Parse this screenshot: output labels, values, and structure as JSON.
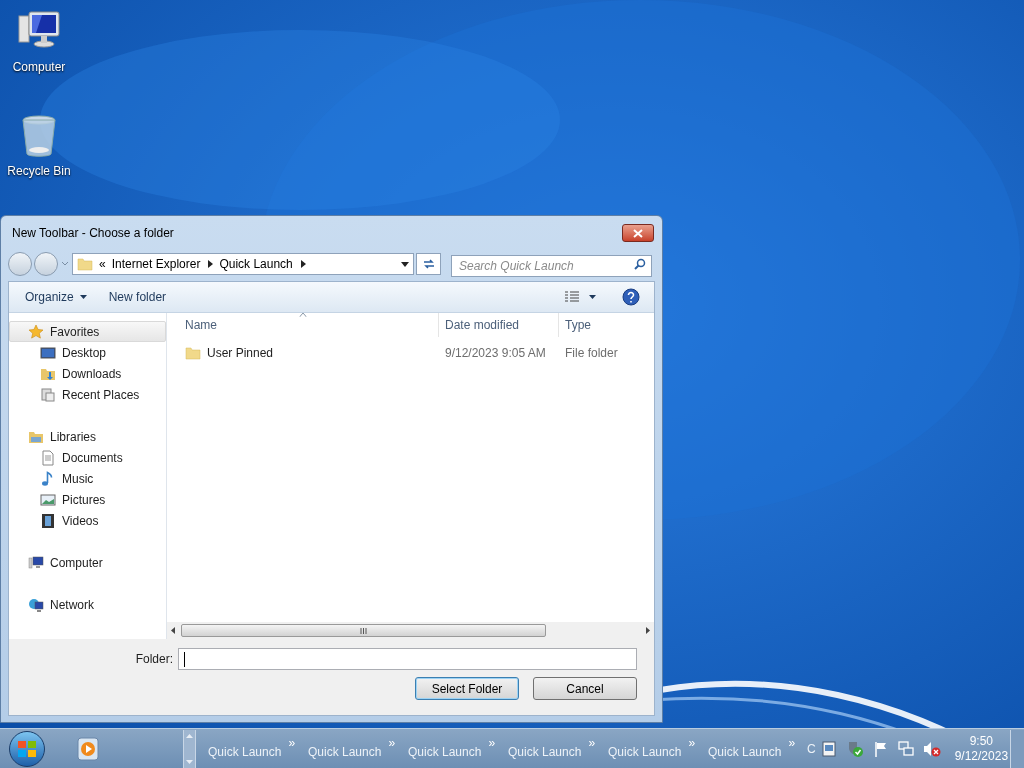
{
  "desktop_icons": [
    {
      "label": "Computer",
      "kind": "computer"
    },
    {
      "label": "Recycle Bin",
      "kind": "recycle"
    }
  ],
  "dialog": {
    "title": "New Toolbar - Choose a folder",
    "breadcrumb": {
      "overflow": "«",
      "items": [
        "Internet Explorer",
        "Quick Launch"
      ]
    },
    "search": {
      "placeholder": "Search Quick Launch"
    },
    "toolbar": {
      "organize": "Organize",
      "new_folder": "New folder"
    },
    "sidebar": [
      {
        "label": "Favorites",
        "kind": "star",
        "selected": true,
        "children": [
          {
            "label": "Desktop",
            "kind": "desktop",
            "selected": false
          },
          {
            "label": "Downloads",
            "kind": "downloads",
            "selected": false
          },
          {
            "label": "Recent Places",
            "kind": "recent",
            "selected": false
          }
        ]
      },
      {
        "label": "Libraries",
        "kind": "libraries",
        "selected": false,
        "children": [
          {
            "label": "Documents",
            "kind": "documents",
            "selected": false
          },
          {
            "label": "Music",
            "kind": "music",
            "selected": false
          },
          {
            "label": "Pictures",
            "kind": "pictures",
            "selected": false
          },
          {
            "label": "Videos",
            "kind": "videos",
            "selected": false
          }
        ]
      },
      {
        "label": "Computer",
        "kind": "computer",
        "selected": false
      },
      {
        "label": "Network",
        "kind": "network",
        "selected": false
      }
    ],
    "columns": [
      {
        "label": "Name",
        "sorted": true
      },
      {
        "label": "Date modified",
        "sorted": false
      },
      {
        "label": "Type",
        "sorted": false
      }
    ],
    "rows": [
      {
        "name": "User Pinned",
        "date": "9/12/2023 9:05 AM",
        "type": "File folder"
      }
    ],
    "folder_label": "Folder:",
    "buttons": [
      {
        "label": "Select Folder",
        "default": true
      },
      {
        "label": "Cancel",
        "default": false
      }
    ]
  },
  "taskbar": {
    "toolbars": [
      {
        "label": "Quick Launch",
        "chevron": "»"
      },
      {
        "label": "Quick Launch",
        "chevron": "»"
      },
      {
        "label": "Quick Launch",
        "chevron": "»"
      },
      {
        "label": "Quick Launch",
        "chevron": "»"
      },
      {
        "label": "Quick Launch",
        "chevron": "»"
      },
      {
        "label": "Quick Launch",
        "chevron": "»"
      }
    ],
    "cut_label": "C",
    "time": "9:50",
    "date": "9/12/2023"
  }
}
